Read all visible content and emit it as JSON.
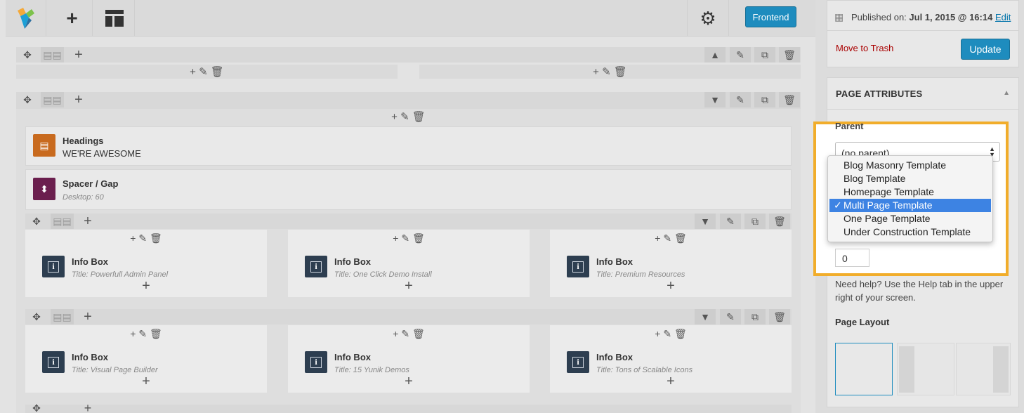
{
  "toolbar": {
    "add_label": "+",
    "frontend_label": "Frontend"
  },
  "rows": {
    "row1_col_tools": "+ ✎ 🗑",
    "row2_col_tools": "+ ✎ 🗑"
  },
  "elements": {
    "headings": {
      "title": "Headings",
      "subtitle": "WE'RE AWESOME"
    },
    "spacer": {
      "title": "Spacer / Gap",
      "subtitle": "Desktop: 60"
    }
  },
  "info_boxes": [
    {
      "title": "Info Box",
      "subtitle": "Title: Powerfull Admin Panel"
    },
    {
      "title": "Info Box",
      "subtitle": "Title: One Click Demo Install"
    },
    {
      "title": "Info Box",
      "subtitle": "Title: Premium Resources"
    },
    {
      "title": "Info Box",
      "subtitle": "Title: Visual Page Builder"
    },
    {
      "title": "Info Box",
      "subtitle": "Title: 15 Yunik Demos"
    },
    {
      "title": "Info Box",
      "subtitle": "Title: Tons of Scalable Icons"
    }
  ],
  "publish": {
    "published_label": "Published on:",
    "published_date": "Jul 1, 2015 @ 16:14",
    "edit_link": "Edit",
    "trash_link": "Move to Trash",
    "update_button": "Update"
  },
  "page_attributes": {
    "heading": "PAGE ATTRIBUTES",
    "parent_label": "Parent",
    "parent_value": "(no parent)",
    "template_options": [
      "Blog Masonry Template",
      "Blog Template",
      "Homepage Template",
      "Multi Page Template",
      "One Page Template",
      "Under Construction Template"
    ],
    "selected_template": "Multi Page Template",
    "order_value": "0",
    "help_text": "Need help? Use the Help tab in the upper right of your screen.",
    "layout_heading": "Page Layout"
  },
  "colors": {
    "accent_blue": "#1e8cbe",
    "highlight_orange": "#f1ad2b",
    "selected_option": "#3d83e3",
    "trash_red": "#a00"
  }
}
